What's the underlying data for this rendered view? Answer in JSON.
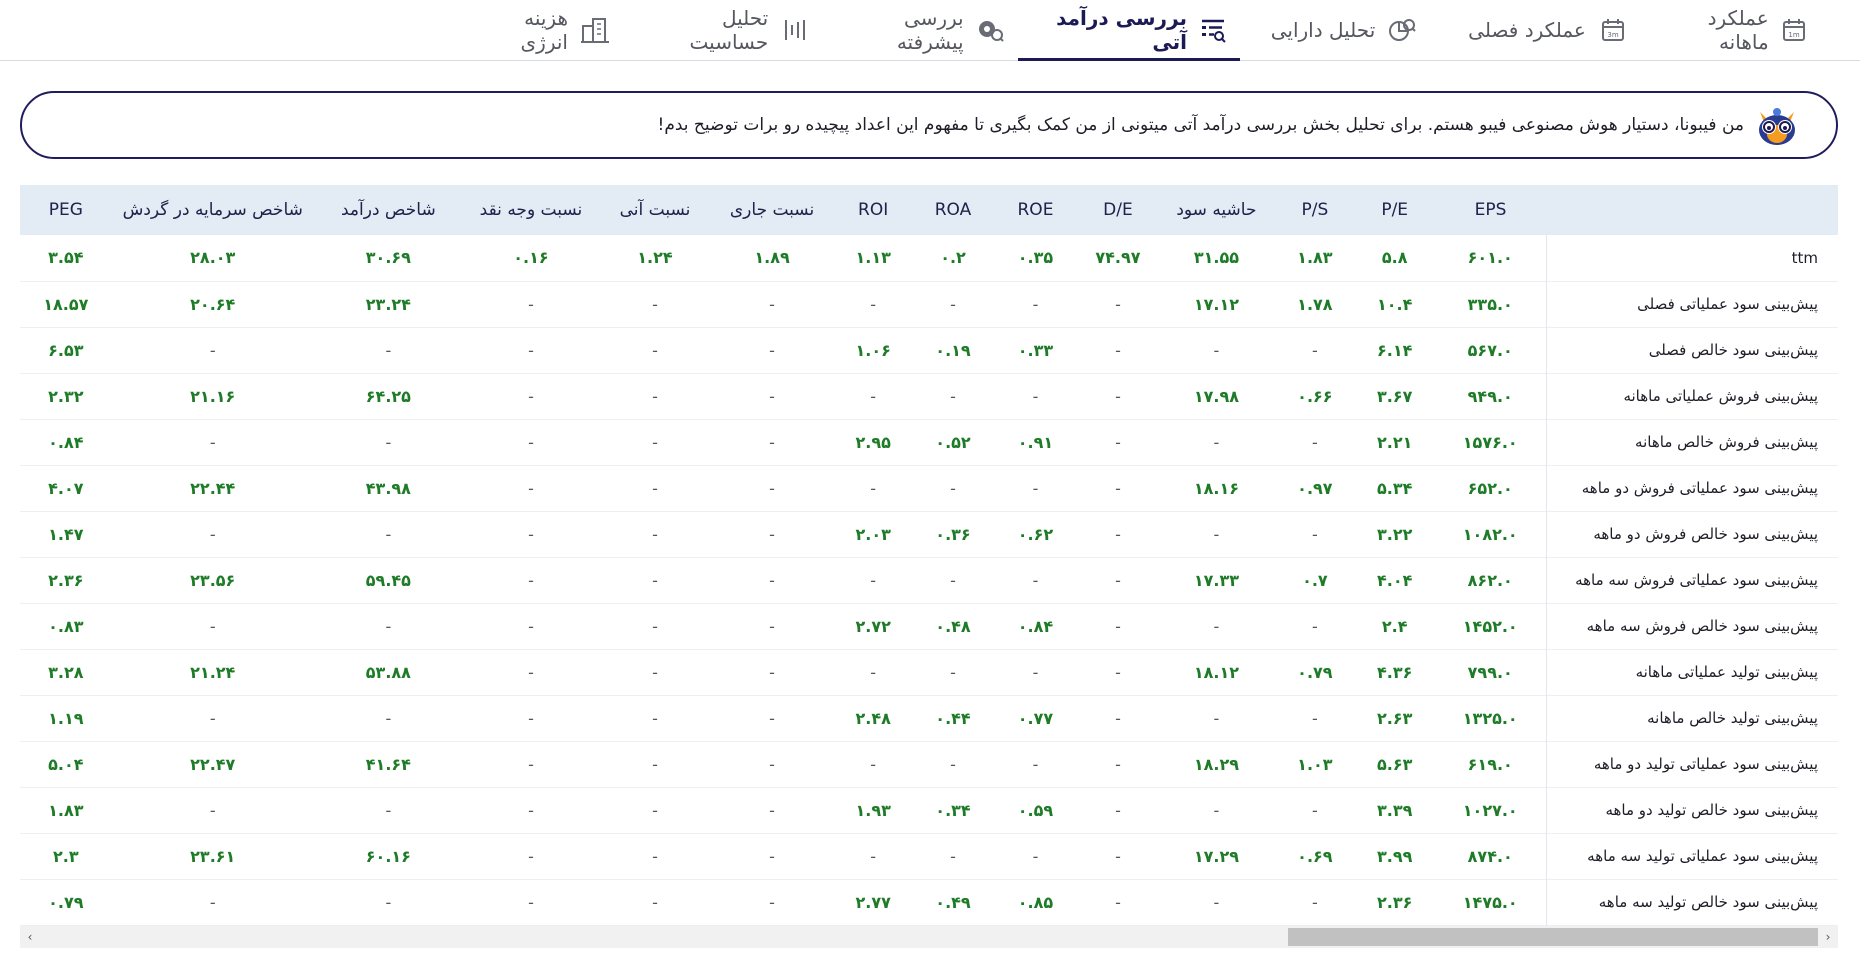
{
  "tabs": [
    {
      "label": "عملکرد ماهانه",
      "icon": "calendar-1m-icon",
      "active": false
    },
    {
      "label": "عملکرد فصلی",
      "icon": "calendar-3m-icon",
      "active": false
    },
    {
      "label": "تحلیل دارایی",
      "icon": "asset-analysis-icon",
      "active": false
    },
    {
      "label": "بررسی درآمد آتی",
      "icon": "forecast-table-icon",
      "active": true
    },
    {
      "label": "بررسی پیشرفته",
      "icon": "advanced-gears-icon",
      "active": false
    },
    {
      "label": "تحلیل حساسیت",
      "icon": "sensitivity-bars-icon",
      "active": false
    },
    {
      "label": "هزینه انرژی",
      "icon": "building-energy-icon",
      "active": false
    }
  ],
  "assistant": {
    "icon": "owl-assistant-icon",
    "message": "من فیبونا، دستیار هوش مصنوعی فیبو هستم. برای تحلیل بخش بررسی درآمد آتی میتونی از من کمک بگیری تا مفهوم این اعداد پیچیده رو برات توضیح بدم!"
  },
  "table": {
    "headers": [
      "",
      "EPS",
      "P/E",
      "P/S",
      "حاشیه سود",
      "D/E",
      "ROE",
      "ROA",
      "ROI",
      "نسبت جاری",
      "نسبت آنی",
      "نسبت وجه نقد",
      "شاخص درآمد",
      "شاخص سرمایه در گردش",
      "PEG"
    ],
    "rows": [
      {
        "label": "ttm",
        "cells": [
          "۶۰۱.۰",
          "۵.۸",
          "۱.۸۳",
          "۳۱.۵۵",
          "۷۴.۹۷",
          "۰.۳۵",
          "۰.۲",
          "۱.۱۳",
          "۱.۸۹",
          "۱.۲۴",
          "۰.۱۶",
          "۳۰.۶۹",
          "۲۸.۰۳",
          "۳.۵۴"
        ]
      },
      {
        "label": "پیش‌بینی سود عملیاتی فصلی",
        "cells": [
          "۳۳۵.۰",
          "۱۰.۴",
          "۱.۷۸",
          "۱۷.۱۲",
          "-",
          "-",
          "-",
          "-",
          "-",
          "-",
          "-",
          "۲۳.۲۴",
          "۲۰.۶۴",
          "۱۸.۵۷"
        ]
      },
      {
        "label": "پیش‌بینی سود خالص فصلی",
        "cells": [
          "۵۶۷.۰",
          "۶.۱۴",
          "-",
          "-",
          "-",
          "۰.۳۳",
          "۰.۱۹",
          "۱.۰۶",
          "-",
          "-",
          "-",
          "-",
          "-",
          "۶.۵۳"
        ]
      },
      {
        "label": "پیش‌بینی فروش عملیاتی ماهانه",
        "cells": [
          "۹۴۹.۰",
          "۳.۶۷",
          "۰.۶۶",
          "۱۷.۹۸",
          "-",
          "-",
          "-",
          "-",
          "-",
          "-",
          "-",
          "۶۴.۲۵",
          "۲۱.۱۶",
          "۲.۳۲"
        ]
      },
      {
        "label": "پیش‌بینی فروش خالص ماهانه",
        "cells": [
          "۱۵۷۶.۰",
          "۲.۲۱",
          "-",
          "-",
          "-",
          "۰.۹۱",
          "۰.۵۲",
          "۲.۹۵",
          "-",
          "-",
          "-",
          "-",
          "-",
          "۰.۸۴"
        ]
      },
      {
        "label": "پیش‌بینی سود عملیاتی فروش دو ماهه",
        "cells": [
          "۶۵۲.۰",
          "۵.۳۴",
          "۰.۹۷",
          "۱۸.۱۶",
          "-",
          "-",
          "-",
          "-",
          "-",
          "-",
          "-",
          "۴۳.۹۸",
          "۲۲.۴۴",
          "۴.۰۷"
        ]
      },
      {
        "label": "پیش‌بینی سود خالص فروش دو ماهه",
        "cells": [
          "۱۰۸۲.۰",
          "۳.۲۲",
          "-",
          "-",
          "-",
          "۰.۶۲",
          "۰.۳۶",
          "۲.۰۳",
          "-",
          "-",
          "-",
          "-",
          "-",
          "۱.۴۷"
        ]
      },
      {
        "label": "پیش‌بینی سود عملیاتی فروش سه ماهه",
        "cells": [
          "۸۶۲.۰",
          "۴.۰۴",
          "۰.۷",
          "۱۷.۳۳",
          "-",
          "-",
          "-",
          "-",
          "-",
          "-",
          "-",
          "۵۹.۴۵",
          "۲۳.۵۶",
          "۲.۳۶"
        ]
      },
      {
        "label": "پیش‌بینی سود خالص فروش سه ماهه",
        "cells": [
          "۱۴۵۲.۰",
          "۲.۴",
          "-",
          "-",
          "-",
          "۰.۸۴",
          "۰.۴۸",
          "۲.۷۲",
          "-",
          "-",
          "-",
          "-",
          "-",
          "۰.۸۳"
        ]
      },
      {
        "label": "پیش‌بینی تولید عملیاتی ماهانه",
        "cells": [
          "۷۹۹.۰",
          "۴.۳۶",
          "۰.۷۹",
          "۱۸.۱۲",
          "-",
          "-",
          "-",
          "-",
          "-",
          "-",
          "-",
          "۵۳.۸۸",
          "۲۱.۲۴",
          "۳.۲۸"
        ]
      },
      {
        "label": "پیش‌بینی تولید خالص ماهانه",
        "cells": [
          "۱۳۲۵.۰",
          "۲.۶۳",
          "-",
          "-",
          "-",
          "۰.۷۷",
          "۰.۴۴",
          "۲.۴۸",
          "-",
          "-",
          "-",
          "-",
          "-",
          "۱.۱۹"
        ]
      },
      {
        "label": "پیش‌بینی سود عملیاتی تولید دو ماهه",
        "cells": [
          "۶۱۹.۰",
          "۵.۶۳",
          "۱.۰۳",
          "۱۸.۲۹",
          "-",
          "-",
          "-",
          "-",
          "-",
          "-",
          "-",
          "۴۱.۶۴",
          "۲۲.۴۷",
          "۵.۰۴"
        ]
      },
      {
        "label": "پیش‌بینی سود خالص تولید دو ماهه",
        "cells": [
          "۱۰۲۷.۰",
          "۳.۳۹",
          "-",
          "-",
          "-",
          "۰.۵۹",
          "۰.۳۴",
          "۱.۹۳",
          "-",
          "-",
          "-",
          "-",
          "-",
          "۱.۸۳"
        ]
      },
      {
        "label": "پیش‌بینی سود عملیاتی تولید سه ماهه",
        "cells": [
          "۸۷۴.۰",
          "۳.۹۹",
          "۰.۶۹",
          "۱۷.۲۹",
          "-",
          "-",
          "-",
          "-",
          "-",
          "-",
          "-",
          "۶۰.۱۶",
          "۲۳.۶۱",
          "۲.۳"
        ]
      },
      {
        "label": "پیش‌بینی سود خالص تولید سه ماهه",
        "cells": [
          "۱۴۷۵.۰",
          "۲.۳۶",
          "-",
          "-",
          "-",
          "۰.۸۵",
          "۰.۴۹",
          "۲.۷۷",
          "-",
          "-",
          "-",
          "-",
          "-",
          "۰.۷۹"
        ]
      }
    ]
  },
  "scrollbar": {
    "left_arrow": "‹",
    "right_arrow": "›"
  },
  "colors": {
    "accent": "#1b1a55",
    "positive": "#1e7b27",
    "header_bg": "#e3ebf5"
  }
}
